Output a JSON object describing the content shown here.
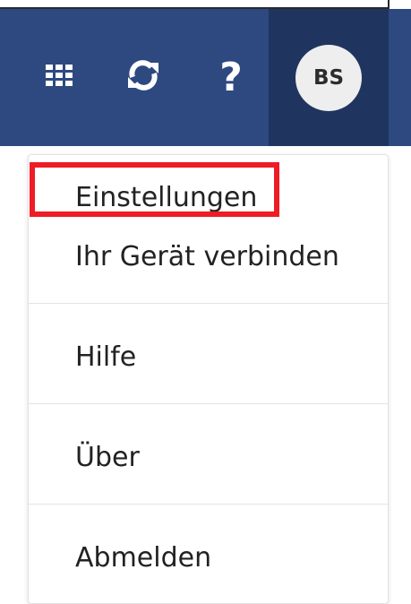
{
  "header": {
    "background_color": "#2d4980",
    "active_background_color": "#1f3560",
    "apps_icon": "waffle-grid-icon",
    "sync_icon": "sync-icon",
    "help_icon": "help-icon",
    "help_glyph": "?",
    "avatar_initials": "BS"
  },
  "menu": {
    "items": [
      {
        "label": "Einstellungen"
      },
      {
        "label": "Ihr Gerät verbinden"
      },
      {
        "label": "Hilfe"
      },
      {
        "label": "Über"
      },
      {
        "label": "Abmelden"
      }
    ]
  },
  "annotation": {
    "highlight_color": "#ee1c25",
    "highlighted_item": "Einstellungen"
  }
}
